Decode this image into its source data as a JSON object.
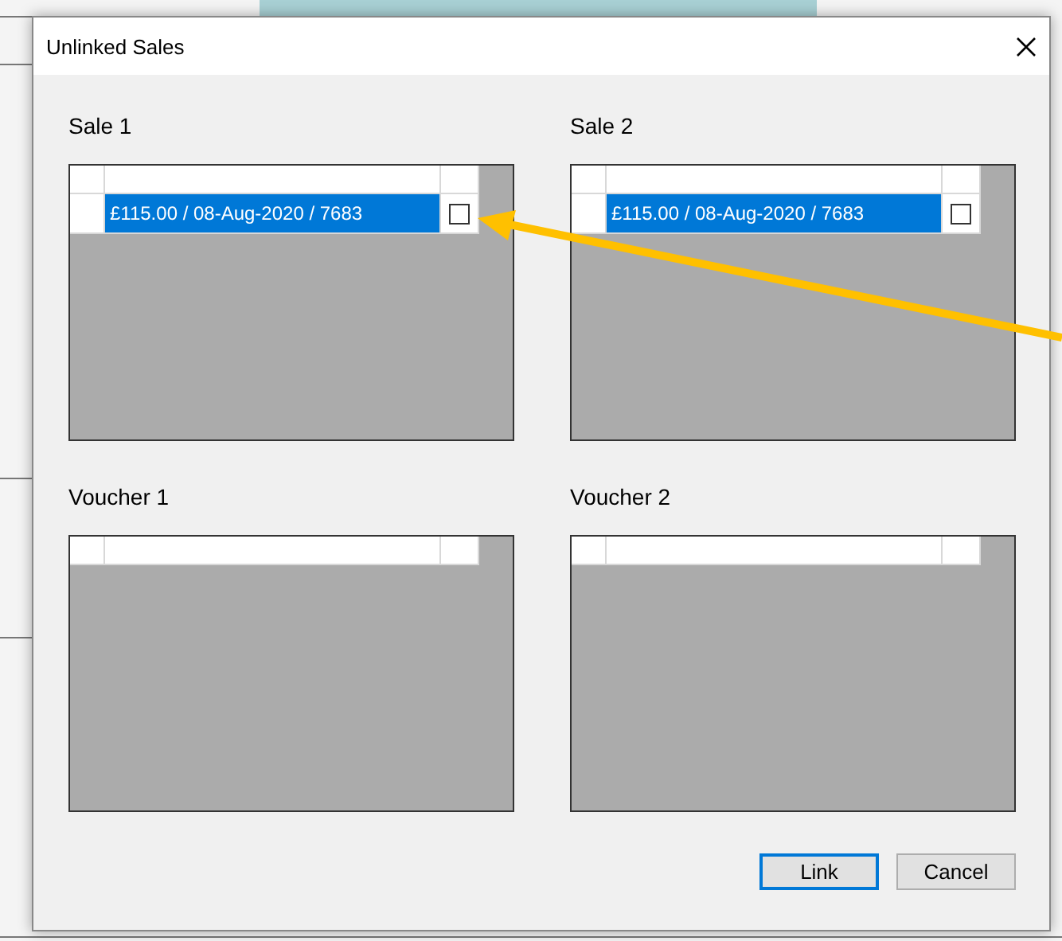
{
  "dialog": {
    "title": "Unlinked Sales"
  },
  "panels": [
    {
      "label": "Sale 1",
      "rows": [
        {
          "text": "£115.00 / 08-Aug-2020 / 7683",
          "selected": true,
          "checked": false
        }
      ]
    },
    {
      "label": "Sale 2",
      "rows": [
        {
          "text": "£115.00 / 08-Aug-2020 / 7683",
          "selected": true,
          "checked": false
        }
      ]
    },
    {
      "label": "Voucher 1"
    },
    {
      "label": "Voucher 2"
    }
  ],
  "buttons": [
    {
      "label": "Link",
      "default": true
    },
    {
      "label": "Cancel",
      "default": false
    }
  ]
}
